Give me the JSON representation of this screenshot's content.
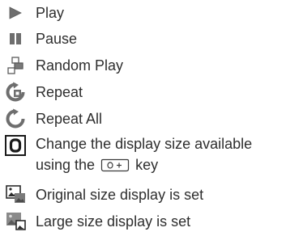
{
  "legend": {
    "items": [
      {
        "icon": "play-icon",
        "label": "Play"
      },
      {
        "icon": "pause-icon",
        "label": "Pause"
      },
      {
        "icon": "random-play-icon",
        "label": "Random Play"
      },
      {
        "icon": "repeat-icon",
        "label": "Repeat"
      },
      {
        "icon": "repeat-all-icon",
        "label": "Repeat All"
      },
      {
        "icon": "display-size-icon",
        "label_line1": "Change the display size available",
        "label_line2_before": "using the",
        "key_icon": "display-key-icon",
        "label_line2_after": "key"
      },
      {
        "icon": "original-size-icon",
        "label": "Original size display is set"
      },
      {
        "icon": "large-size-icon",
        "label": "Large size display is set"
      }
    ]
  },
  "colors": {
    "icon_gray": "#6e6e6e",
    "icon_dark": "#2b2b2b",
    "text": "#2e2e2e"
  }
}
